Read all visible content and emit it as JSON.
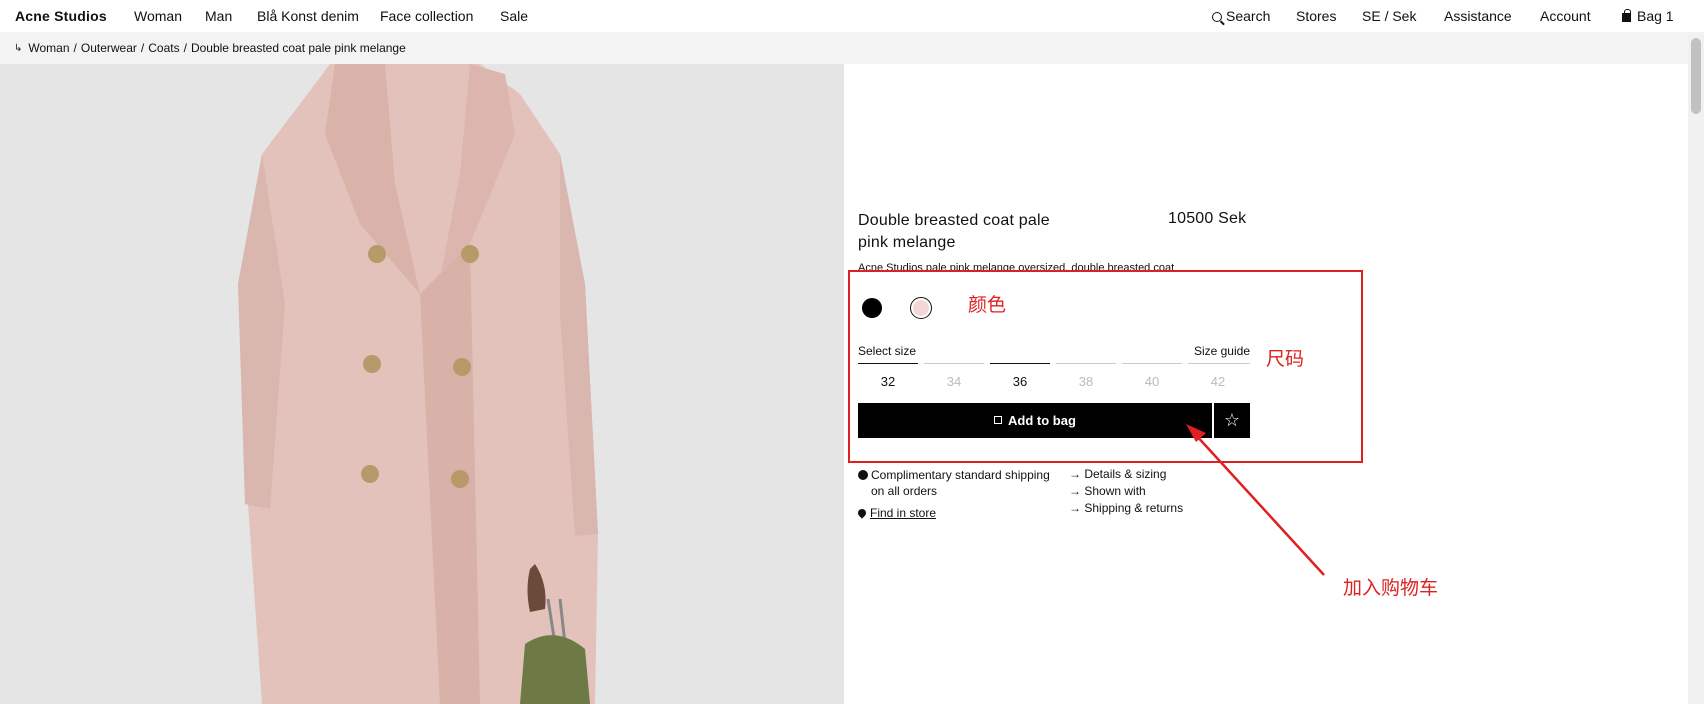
{
  "header": {
    "brand": "Acne Studios",
    "nav_left": [
      "Woman",
      "Man",
      "Blå Konst denim",
      "Face collection",
      "Sale"
    ],
    "search_label": "Search",
    "stores_label": "Stores",
    "region_label": "SE / Sek",
    "assistance_label": "Assistance",
    "account_label": "Account",
    "bag_label": "Bag 1"
  },
  "breadcrumb": {
    "items": [
      "Woman",
      "Outerwear",
      "Coats"
    ],
    "current": "Double breasted coat pale pink melange"
  },
  "product": {
    "name": "Double breasted coat pale pink melange",
    "price": "10500 Sek",
    "description": "Acne Studios pale pink melange oversized, double breasted coat",
    "colors": [
      {
        "name": "black",
        "hex": "#000000"
      },
      {
        "name": "pale-pink",
        "hex": "#f3d6d6",
        "selected": true
      }
    ],
    "select_size_label": "Select size",
    "size_guide_label": "Size guide",
    "sizes": [
      {
        "label": "32",
        "available": true
      },
      {
        "label": "34",
        "available": false
      },
      {
        "label": "36",
        "available": true,
        "selected": true
      },
      {
        "label": "38",
        "available": false
      },
      {
        "label": "40",
        "available": false
      },
      {
        "label": "42",
        "available": false
      }
    ],
    "add_to_bag_label": "Add to bag",
    "shipping_line1": "Complimentary standard shipping",
    "shipping_line2": "on all orders",
    "find_in_store_label": "Find in store",
    "info_links": [
      "Details & sizing",
      "Shown with",
      "Shipping & returns"
    ]
  },
  "annotations": {
    "color_label": "颜色",
    "size_label": "尺码",
    "add_to_cart_label": "加入购物车",
    "accent_color": "#e02020"
  },
  "colors": {
    "coat": "#e6c3bd",
    "background": "#e4e4e4",
    "button": "#000000"
  }
}
